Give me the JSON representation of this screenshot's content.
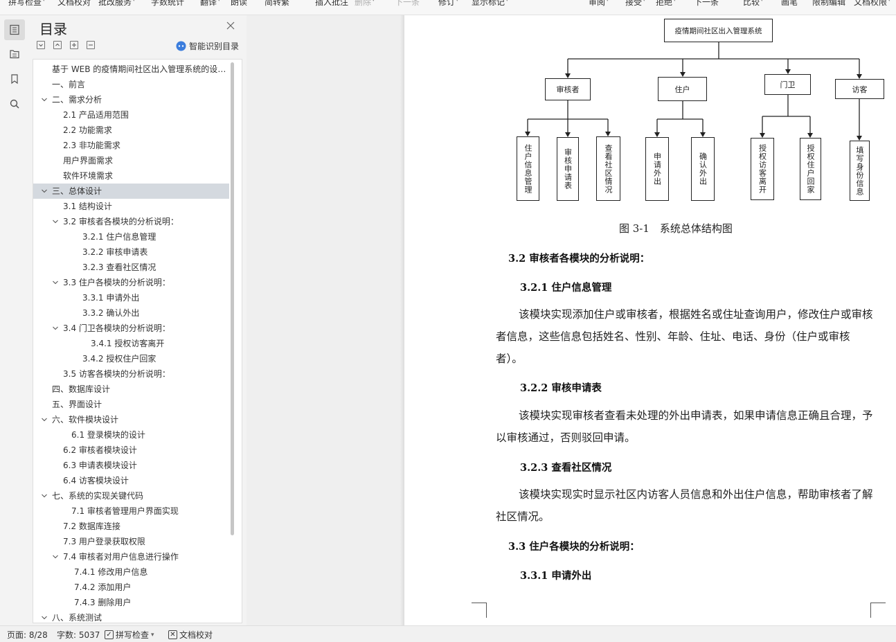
{
  "toolbar": {
    "items": [
      {
        "label": "拼写检查",
        "dropdown": true,
        "dim": false
      },
      {
        "label": "文档校对",
        "dropdown": false,
        "dim": false
      },
      {
        "label": "批改服务",
        "dropdown": true,
        "dim": false
      },
      {
        "label": "字数统计",
        "dropdown": false,
        "dim": false
      },
      {
        "label": "翻译",
        "dropdown": true,
        "dim": false
      },
      {
        "label": "朗读",
        "dropdown": false,
        "dim": false
      },
      {
        "label": "简转繁",
        "dropdown": false,
        "dim": false
      },
      {
        "label": "插入批注",
        "dropdown": false,
        "dim": false
      },
      {
        "label": "删除",
        "dropdown": true,
        "dim": true
      },
      {
        "label": "下一条",
        "dropdown": false,
        "dim": true
      },
      {
        "label": "修订",
        "dropdown": true,
        "dim": false
      },
      {
        "label": "显示标记",
        "dropdown": true,
        "dim": false
      },
      {
        "label": "审阅",
        "dropdown": true,
        "dim": false
      },
      {
        "label": "接受",
        "dropdown": true,
        "dim": false
      },
      {
        "label": "拒绝",
        "dropdown": true,
        "dim": false
      },
      {
        "label": "下一条",
        "dropdown": false,
        "dim": false
      },
      {
        "label": "比较",
        "dropdown": true,
        "dim": false
      },
      {
        "label": "画笔",
        "dropdown": false,
        "dim": false
      },
      {
        "label": "限制编辑",
        "dropdown": false,
        "dim": false
      },
      {
        "label": "文档权限",
        "dropdown": true,
        "dim": false
      }
    ]
  },
  "rail": {
    "icons": [
      "toc-icon",
      "folder-tree-icon",
      "bookmark-icon",
      "search-icon"
    ]
  },
  "toc": {
    "title": "目录",
    "smart_label": "智能识别目录",
    "items": [
      {
        "text": "基于 WEB 的疫情期间社区出入管理系统的设计与实现",
        "level": 0,
        "caret": "",
        "selected": false
      },
      {
        "text": "一、前言",
        "level": 0,
        "caret": "",
        "selected": false
      },
      {
        "text": "二、需求分析",
        "level": 0,
        "caret": "open",
        "selected": false
      },
      {
        "text": "2.1 产品适用范围",
        "level": 1,
        "caret": "",
        "selected": false
      },
      {
        "text": "2.2 功能需求",
        "level": 1,
        "caret": "",
        "selected": false
      },
      {
        "text": "2.3 非功能需求",
        "level": 1,
        "caret": "",
        "selected": false
      },
      {
        "text": "用户界面需求",
        "level": 1,
        "caret": "",
        "selected": false
      },
      {
        "text": "软件环境需求",
        "level": 1,
        "caret": "",
        "selected": false
      },
      {
        "text": "三、总体设计",
        "level": 0,
        "caret": "open",
        "selected": true
      },
      {
        "text": "3.1 结构设计",
        "level": 1,
        "caret": "",
        "selected": false
      },
      {
        "text": "3.2 审核者各模块的分析说明：",
        "level": 1,
        "caret": "open",
        "selected": false
      },
      {
        "text": "3.2.1 住户信息管理",
        "level": 2,
        "caret": "",
        "selected": false
      },
      {
        "text": "3.2.2  审核申请表",
        "level": 2,
        "caret": "",
        "selected": false
      },
      {
        "text": "3.2.3  查看社区情况",
        "level": 2,
        "caret": "",
        "selected": false
      },
      {
        "text": "3.3 住户各模块的分析说明：",
        "level": 1,
        "caret": "open",
        "selected": false
      },
      {
        "text": "3.3.1 申请外出",
        "level": 2,
        "caret": "",
        "selected": false
      },
      {
        "text": "3.3.2  确认外出",
        "level": 2,
        "caret": "",
        "selected": false
      },
      {
        "text": "3.4 门卫各模块的分析说明：",
        "level": 1,
        "caret": "open",
        "selected": false
      },
      {
        "text": "3.4.1  授权访客离开",
        "level": 3,
        "caret": "",
        "selected": false
      },
      {
        "text": "3.4.2  授权住户回家",
        "level": 2,
        "caret": "",
        "selected": false
      },
      {
        "text": "3.5 访客各模块的分析说明：",
        "level": 1,
        "caret": "",
        "selected": false
      },
      {
        "text": "四、数据库设计",
        "level": 0,
        "caret": "",
        "selected": false
      },
      {
        "text": "五、界面设计",
        "level": 0,
        "caret": "",
        "selected": false
      },
      {
        "text": "六、软件模块设计",
        "level": 0,
        "caret": "open",
        "selected": false
      },
      {
        "text": "6.1 登录模块的设计",
        "level": 4,
        "caret": "",
        "selected": false
      },
      {
        "text": "6.2 审核者模块设计",
        "level": 1,
        "caret": "",
        "selected": false
      },
      {
        "text": "6.3 申请表模块设计",
        "level": 1,
        "caret": "",
        "selected": false
      },
      {
        "text": "6.4 访客模块设计",
        "level": 1,
        "caret": "",
        "selected": false
      },
      {
        "text": "七、系统的实现关键代码",
        "level": 0,
        "caret": "open",
        "selected": false
      },
      {
        "text": "7.1 审核者管理用户界面实现",
        "level": 4,
        "caret": "",
        "selected": false
      },
      {
        "text": "7.2  数据库连接",
        "level": 1,
        "caret": "",
        "selected": false
      },
      {
        "text": "7.3 用户登录获取权限",
        "level": 1,
        "caret": "",
        "selected": false
      },
      {
        "text": "7.4 审核者对用户信息进行操作",
        "level": 1,
        "caret": "open",
        "selected": false
      },
      {
        "text": "7.4.1  修改用户信息",
        "level": 5,
        "caret": "",
        "selected": false
      },
      {
        "text": "7.4.2  添加用户",
        "level": 5,
        "caret": "",
        "selected": false
      },
      {
        "text": "7.4.3  删除用户",
        "level": 5,
        "caret": "",
        "selected": false
      },
      {
        "text": "八、系统测试",
        "level": 0,
        "caret": "open",
        "selected": false
      }
    ]
  },
  "diagram": {
    "root": "疫情期间社区出入管理系统",
    "groups": [
      {
        "label": "审核者",
        "children": [
          "住户信息管理",
          "审核申请表",
          "查看社区情况"
        ]
      },
      {
        "label": "住户",
        "children": [
          "申请外出",
          "确认外出"
        ]
      },
      {
        "label": "门卫",
        "children": [
          "授权访客离开",
          "授权住户回家"
        ]
      },
      {
        "label": "访客",
        "children": [
          "填写身份信息"
        ]
      }
    ],
    "caption": "图 3-1　系统总体结构图"
  },
  "document": {
    "h_3_2": "3.2 审核者各模块的分析说明：",
    "h_3_2_1": "3.2.1 住户信息管理",
    "p_3_2_1": "该模块实现添加住户或审核者，根据姓名或住址查询用户，修改住户或审核者信息，这些信息包括姓名、性别、年龄、住址、电话、身份（住户或审核者）。",
    "h_3_2_2": "3.2.2  审核申请表",
    "p_3_2_2": "该模块实现审核者查看未处理的外出申请表，如果申请信息正确且合理，予以审核通过，否则驳回申请。",
    "h_3_2_3": "3.2.3  查看社区情况",
    "p_3_2_3": "该模块实现实时显示社区内访客人员信息和外出住户信息，帮助审核者了解社区情况。",
    "h_3_3": "3.3 住户各模块的分析说明：",
    "h_3_3_1": "3.3.1 申请外出"
  },
  "status": {
    "page": "页面: 8/28",
    "words": "字数: 5037",
    "spell": "拼写检查",
    "proof": "文档校对"
  },
  "colors": {
    "selected_row": "#d4d9df",
    "smart_icon": "#3b7ddd"
  }
}
